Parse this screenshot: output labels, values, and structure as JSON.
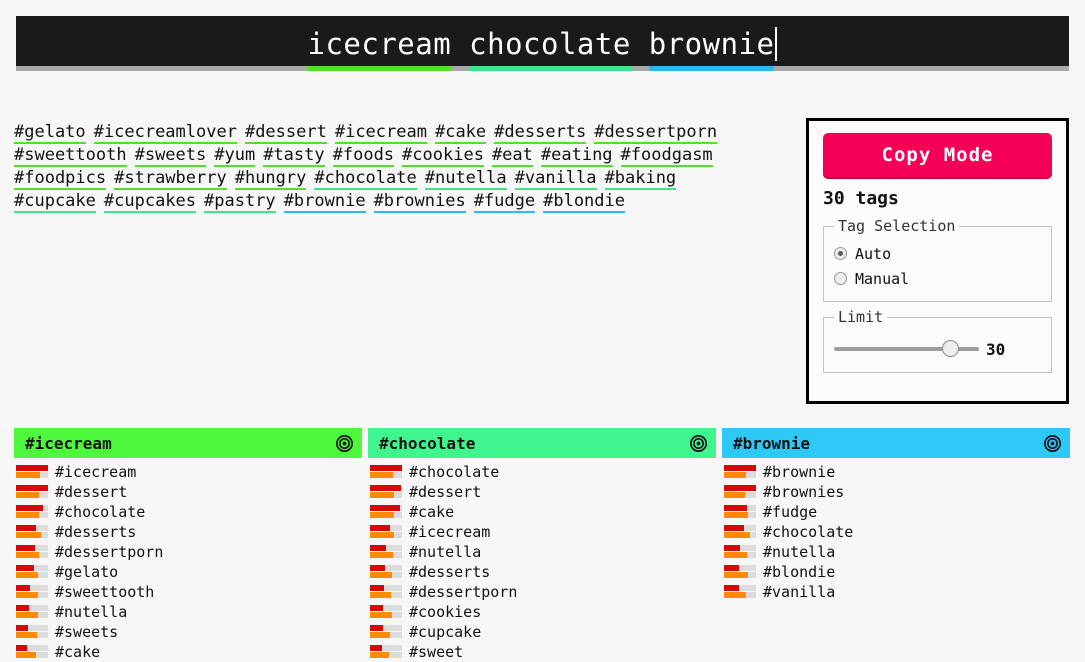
{
  "header": {
    "query_words": [
      "icecream",
      "chocolate",
      "brownie"
    ],
    "underline_colors": [
      "#52e02c",
      "#3ee68a",
      "#29baf5"
    ],
    "caret_visible": true,
    "background": "#1a1a1a",
    "rule_color": "#a8a8a8"
  },
  "tag_cloud": {
    "rows": [
      [
        {
          "label": "#gelato",
          "color": "#52e02c"
        },
        {
          "label": "#icecreamlover",
          "color": "#52e02c"
        },
        {
          "label": "#dessert",
          "color": "#52e02c"
        },
        {
          "label": "#icecream",
          "color": "#52e02c"
        },
        {
          "label": "#cake",
          "color": "#52e02c"
        },
        {
          "label": "#desserts",
          "color": "#52e02c"
        },
        {
          "label": "#dessertporn",
          "color": "#52e02c"
        }
      ],
      [
        {
          "label": "#sweettooth",
          "color": "#52e02c"
        },
        {
          "label": "#sweets",
          "color": "#52e02c"
        },
        {
          "label": "#yum",
          "color": "#52e02c"
        },
        {
          "label": "#tasty",
          "color": "#52e02c"
        },
        {
          "label": "#foods",
          "color": "#52e02c"
        },
        {
          "label": "#cookies",
          "color": "#52e02c"
        },
        {
          "label": "#eat",
          "color": "#52e02c"
        },
        {
          "label": "#eating",
          "color": "#52e02c"
        },
        {
          "label": "#foodgasm",
          "color": "#52e02c"
        }
      ],
      [
        {
          "label": "#foodpics",
          "color": "#52e02c"
        },
        {
          "label": "#strawberry",
          "color": "#52e02c"
        },
        {
          "label": "#hungry",
          "color": "#52e02c"
        },
        {
          "label": "#chocolate",
          "color": "#3ee68a"
        },
        {
          "label": "#nutella",
          "color": "#3ee68a"
        },
        {
          "label": "#vanilla",
          "color": "#3ee68a"
        },
        {
          "label": "#baking",
          "color": "#3ee68a"
        }
      ],
      [
        {
          "label": "#cupcake",
          "color": "#3ee68a"
        },
        {
          "label": "#cupcakes",
          "color": "#3ee68a"
        },
        {
          "label": "#pastry",
          "color": "#3ee68a"
        },
        {
          "label": "#brownie",
          "color": "#29baf5"
        },
        {
          "label": "#brownies",
          "color": "#29baf5"
        },
        {
          "label": "#fudge",
          "color": "#29baf5"
        },
        {
          "label": "#blondie",
          "color": "#29baf5"
        }
      ]
    ]
  },
  "side_panel": {
    "copy_mode_label": "Copy Mode",
    "copy_mode_color": "#f50057",
    "tag_count_text": "30 tags",
    "tag_selection": {
      "legend": "Tag Selection",
      "options": [
        {
          "label": "Auto",
          "checked": true
        },
        {
          "label": "Manual",
          "checked": false
        }
      ]
    },
    "limit": {
      "legend": "Limit",
      "value": "30",
      "percent": 80
    }
  },
  "columns": [
    {
      "header_label": "#icecream",
      "header_color": "#4ef83c",
      "icon": "target-icon",
      "items": [
        {
          "label": "#icecream",
          "red": 100,
          "orange": 75
        },
        {
          "label": "#dessert",
          "red": 100,
          "orange": 72
        },
        {
          "label": "#chocolate",
          "red": 84,
          "orange": 72
        },
        {
          "label": "#desserts",
          "red": 62,
          "orange": 78
        },
        {
          "label": "#dessertporn",
          "red": 58,
          "orange": 72
        },
        {
          "label": "#gelato",
          "red": 56,
          "orange": 70
        },
        {
          "label": "#sweettooth",
          "red": 44,
          "orange": 70
        },
        {
          "label": "#nutella",
          "red": 40,
          "orange": 70
        },
        {
          "label": "#sweets",
          "red": 38,
          "orange": 66
        },
        {
          "label": "#cake",
          "red": 34,
          "orange": 62
        }
      ]
    },
    {
      "header_label": "#chocolate",
      "header_color": "#3ef58e",
      "icon": "target-icon",
      "items": [
        {
          "label": "#chocolate",
          "red": 100,
          "orange": 72
        },
        {
          "label": "#dessert",
          "red": 96,
          "orange": 76
        },
        {
          "label": "#cake",
          "red": 94,
          "orange": 74
        },
        {
          "label": "#icecream",
          "red": 62,
          "orange": 76
        },
        {
          "label": "#nutella",
          "red": 50,
          "orange": 72
        },
        {
          "label": "#desserts",
          "red": 46,
          "orange": 70
        },
        {
          "label": "#dessertporn",
          "red": 44,
          "orange": 66
        },
        {
          "label": "#cookies",
          "red": 42,
          "orange": 70
        },
        {
          "label": "#cupcake",
          "red": 40,
          "orange": 64
        },
        {
          "label": "#sweet",
          "red": 36,
          "orange": 60
        }
      ]
    },
    {
      "header_label": "#brownie",
      "header_color": "#2ec8f7",
      "icon": "target-icon",
      "items": [
        {
          "label": "#brownie",
          "red": 100,
          "orange": 68
        },
        {
          "label": "#brownies",
          "red": 100,
          "orange": 66
        },
        {
          "label": "#fudge",
          "red": 72,
          "orange": 74
        },
        {
          "label": "#chocolate",
          "red": 62,
          "orange": 80
        },
        {
          "label": "#nutella",
          "red": 50,
          "orange": 72
        },
        {
          "label": "#blondie",
          "red": 48,
          "orange": 74
        },
        {
          "label": "#vanilla",
          "red": 46,
          "orange": 68
        }
      ]
    }
  ]
}
